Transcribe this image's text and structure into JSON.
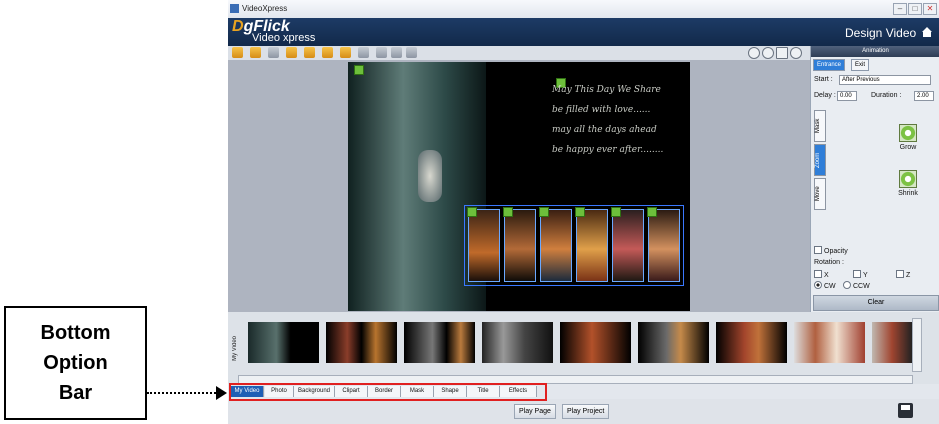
{
  "callout": {
    "lines": [
      "Bottom",
      "Option",
      "Bar"
    ]
  },
  "window": {
    "title": "VideoXpress",
    "controls": [
      "–",
      "□",
      "✕"
    ]
  },
  "brand": {
    "logo_prefix": "D",
    "logo_main": "gFlick",
    "logo_sub": "Video xpress",
    "mode_label": "Design Video"
  },
  "stage": {
    "poem_lines": [
      "May This Day We Share",
      "be filled with love......",
      "may all the days ahead",
      "be happy ever after........"
    ]
  },
  "panel": {
    "title": "Animation",
    "tabs": [
      "Entrance",
      "Exit"
    ],
    "start_label": "Start :",
    "start_value": "After Previous",
    "delay_label": "Delay :",
    "delay_value": "0.00",
    "duration_label": "Duration :",
    "duration_value": "2.00",
    "vertical_tabs": [
      "Mask",
      "Zoom",
      "Move"
    ],
    "effects": [
      "Grow",
      "Shrink"
    ],
    "opacity_label": "Opacity",
    "rotation_label": "Rotation :",
    "axes": [
      "X",
      "Y",
      "Z"
    ],
    "directions": [
      "CW",
      "CCW"
    ],
    "clear_label": "Clear"
  },
  "strip": {
    "side_label": "My Video"
  },
  "options": [
    "My Video",
    "Photo",
    "Background",
    "Clipart",
    "Border",
    "Mask",
    "Shape",
    "Title",
    "Effects"
  ],
  "footer": {
    "play_page": "Play Page",
    "play_project": "Play Project"
  },
  "colors": {
    "accent_blue": "#2f7ed8",
    "highlight_red": "#e02020",
    "brand_navy": "#1d3b66"
  }
}
